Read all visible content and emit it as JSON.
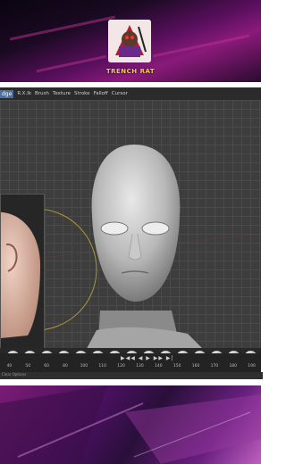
{
  "top_banner": {
    "logo_text": "TRENCH RAT"
  },
  "blender": {
    "header_mode": "Sculpt Mode",
    "header_menus": [
      "View",
      "Sculpt",
      "Mask",
      "Face Sets",
      "Brush",
      "Texture",
      "Stroke",
      "Falloff",
      "Cursor"
    ],
    "visible_header_labels": [
      "dge",
      "R.X.Ik",
      "Brush",
      "Texture",
      "Stroke",
      "Falloff",
      "Cursor"
    ],
    "playback_controls": "▶◀◀ ◀ ▶ ▶▶ ▶|",
    "timeline_ticks": [
      "40",
      "50",
      "60",
      "80",
      "100",
      "110",
      "120",
      "130",
      "140",
      "150",
      "160",
      "170",
      "180",
      "190"
    ],
    "status_text": "Clear  Options"
  },
  "colors": {
    "accent_blue": "#4a7ac0",
    "magenta": "#8a1a7a"
  }
}
